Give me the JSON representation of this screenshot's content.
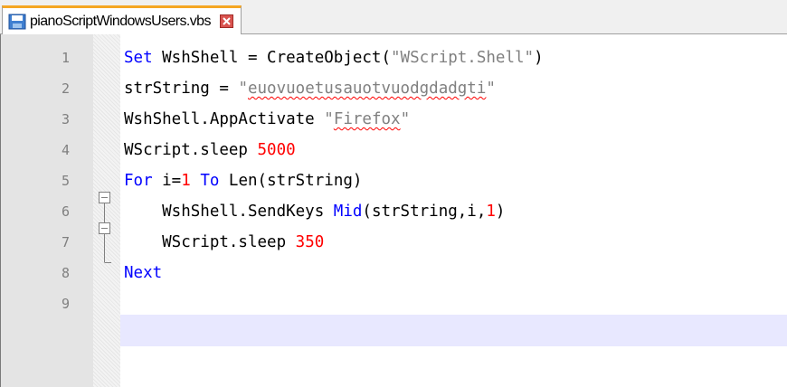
{
  "tab": {
    "filename": "pianoScriptWindowsUsers.vbs",
    "icon": "save-icon",
    "close_icon": "close-icon"
  },
  "editor": {
    "language": "VBScript",
    "current_line": 9,
    "lines": [
      {
        "number": "1",
        "tokens": [
          {
            "t": "Set",
            "c": "kw"
          },
          {
            "t": " WshShell = CreateObject(",
            "c": ""
          },
          {
            "t": "\"WScript.Shell\"",
            "c": "str"
          },
          {
            "t": ")",
            "c": ""
          }
        ]
      },
      {
        "number": "2",
        "tokens": [
          {
            "t": "strString = ",
            "c": ""
          },
          {
            "t": "\"",
            "c": "str"
          },
          {
            "t": "euovuoetusauotvuodgdadgti",
            "c": "str spell"
          },
          {
            "t": "\"",
            "c": "str"
          }
        ]
      },
      {
        "number": "3",
        "tokens": [
          {
            "t": "WshShell.AppActivate ",
            "c": ""
          },
          {
            "t": "\"",
            "c": "str"
          },
          {
            "t": "Firefox",
            "c": "str spell"
          },
          {
            "t": "\"",
            "c": "str"
          }
        ]
      },
      {
        "number": "4",
        "tokens": [
          {
            "t": "WScript.sleep ",
            "c": ""
          },
          {
            "t": "5000",
            "c": "num"
          }
        ]
      },
      {
        "number": "5",
        "tokens": [
          {
            "t": "For",
            "c": "kw"
          },
          {
            "t": " i=",
            "c": ""
          },
          {
            "t": "1",
            "c": "num"
          },
          {
            "t": " ",
            "c": ""
          },
          {
            "t": "To",
            "c": "kw"
          },
          {
            "t": " Len(strString)",
            "c": ""
          }
        ]
      },
      {
        "number": "6",
        "tokens": [
          {
            "t": "    WshShell.SendKeys ",
            "c": ""
          },
          {
            "t": "Mid",
            "c": "kw"
          },
          {
            "t": "(strString,i,",
            "c": ""
          },
          {
            "t": "1",
            "c": "num"
          },
          {
            "t": ")",
            "c": ""
          }
        ]
      },
      {
        "number": "7",
        "tokens": [
          {
            "t": "    WScript.sleep ",
            "c": ""
          },
          {
            "t": "350",
            "c": "num"
          }
        ]
      },
      {
        "number": "8",
        "tokens": [
          {
            "t": "Next",
            "c": "kw"
          }
        ]
      },
      {
        "number": "9",
        "tokens": []
      }
    ]
  },
  "colors": {
    "keyword": "#0000ff",
    "string": "#808080",
    "number": "#ff0000",
    "current_line_bg": "#e8e8ff",
    "tab_accent": "#f5a623"
  }
}
